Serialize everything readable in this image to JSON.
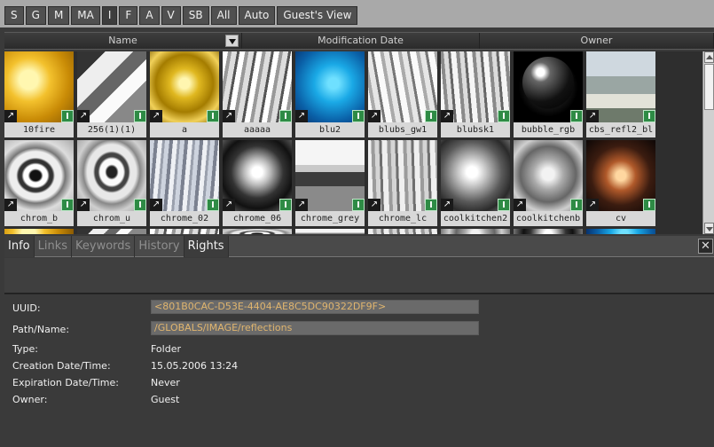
{
  "tabs": [
    "S",
    "G",
    "M",
    "MA",
    "I",
    "F",
    "A",
    "V",
    "SB",
    "All",
    "Auto",
    "Guest's View"
  ],
  "active_tab": "I",
  "columns": {
    "name": "Name",
    "modified": "Modification Date",
    "owner": "Owner"
  },
  "thumbnails": {
    "row1": [
      "10fire",
      "256(1)(1)",
      "a",
      "aaaaa",
      "blu2",
      "blubs_gw1",
      "blubsk1",
      "bubble_rgb",
      "cbs_refl2_bl"
    ],
    "row2": [
      "chrom_b",
      "chrom_u",
      "chrome_02",
      "chrome_06",
      "chrome_grey",
      "chrome_lc",
      "coolkitchen2",
      "coolkitchenb",
      "cv"
    ]
  },
  "badges": {
    "link": "↗",
    "info": "I"
  },
  "info_tabs": [
    "Info",
    "Links",
    "Keywords",
    "History",
    "Rights"
  ],
  "info_tabs_active": "Info",
  "close_label": "✕",
  "info": {
    "uuid_label": "UUID:",
    "uuid_value": "<801B0CAC-D53E-4404-AE8C5DC90322DF9F>",
    "path_label": "Path/Name:",
    "path_value": "/GLOBALS/IMAGE/reflections",
    "type_label": "Type:",
    "type_value": "Folder",
    "created_label": "Creation Date/Time:",
    "created_value": "15.05.2006 13:24",
    "expires_label": "Expiration Date/Time:",
    "expires_value": "Never",
    "owner_label": "Owner:",
    "owner_value": "Guest"
  },
  "colors": {
    "field_highlight": "#e0b56e",
    "badge_green": "#2e8b45"
  }
}
